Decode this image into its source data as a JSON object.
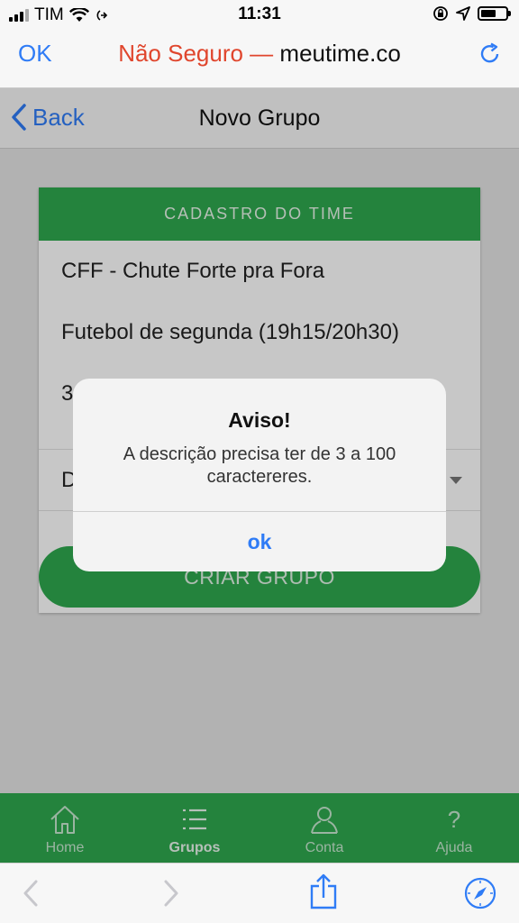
{
  "status_bar": {
    "carrier": "TIM",
    "time": "11:31",
    "battery_level": 0.6
  },
  "safari": {
    "done_label": "OK",
    "insecure_label": "Não Seguro —",
    "host": "meutime.co"
  },
  "nav": {
    "back_label": "Back",
    "title": "Novo Grupo"
  },
  "form": {
    "header": "CADASTRO DO TIME",
    "name_value": "CFF - Chute Forte pra Fora",
    "description_value": "Futebol de segunda (19h15/20h30)",
    "third_field_value": "3",
    "select_value": "D",
    "submit_label": "CRIAR GRUPO"
  },
  "tabs": [
    {
      "label": "Home",
      "icon": "home-icon"
    },
    {
      "label": "Grupos",
      "icon": "list-icon",
      "active": true
    },
    {
      "label": "Conta",
      "icon": "user-icon"
    },
    {
      "label": "Ajuda",
      "icon": "question-icon"
    }
  ],
  "alert": {
    "title": "Aviso!",
    "message": "A descrição precisa ter de 3 a 100 caractereres.",
    "ok_label": "ok"
  },
  "colors": {
    "accent_green": "#2fa84f",
    "ios_blue": "#2f7cf6",
    "insecure_red": "#e0462d"
  }
}
